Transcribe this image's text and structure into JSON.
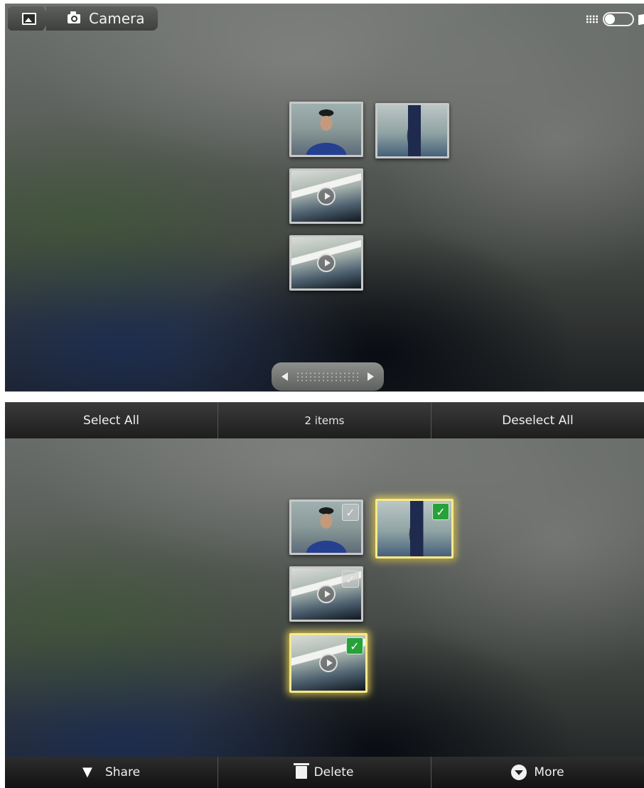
{
  "top_screen": {
    "breadcrumb": {
      "home_icon": "gallery-icon",
      "album_icon": "camera-icon",
      "album_label": "Camera"
    },
    "view_toggle": {
      "grid_icon": "grid-icon",
      "stack_icon": "stack-icon"
    },
    "thumbnails": [
      {
        "type": "photo",
        "subject": "face"
      },
      {
        "type": "photo",
        "subject": "jar"
      },
      {
        "type": "video"
      },
      {
        "type": "video"
      }
    ]
  },
  "bottom_screen": {
    "selection_bar": {
      "select_all_label": "Select All",
      "count_label": "2 items",
      "deselect_all_label": "Deselect All"
    },
    "thumbnails": [
      {
        "type": "photo",
        "subject": "face",
        "selected": false
      },
      {
        "type": "photo",
        "subject": "jar",
        "selected": true
      },
      {
        "type": "video",
        "selected": false
      },
      {
        "type": "video",
        "selected": true
      }
    ],
    "action_bar": {
      "share_label": "Share",
      "delete_label": "Delete",
      "more_label": "More"
    }
  },
  "colors": {
    "selection_highlight": "#f6e98c",
    "check_on": "#27a13a"
  }
}
